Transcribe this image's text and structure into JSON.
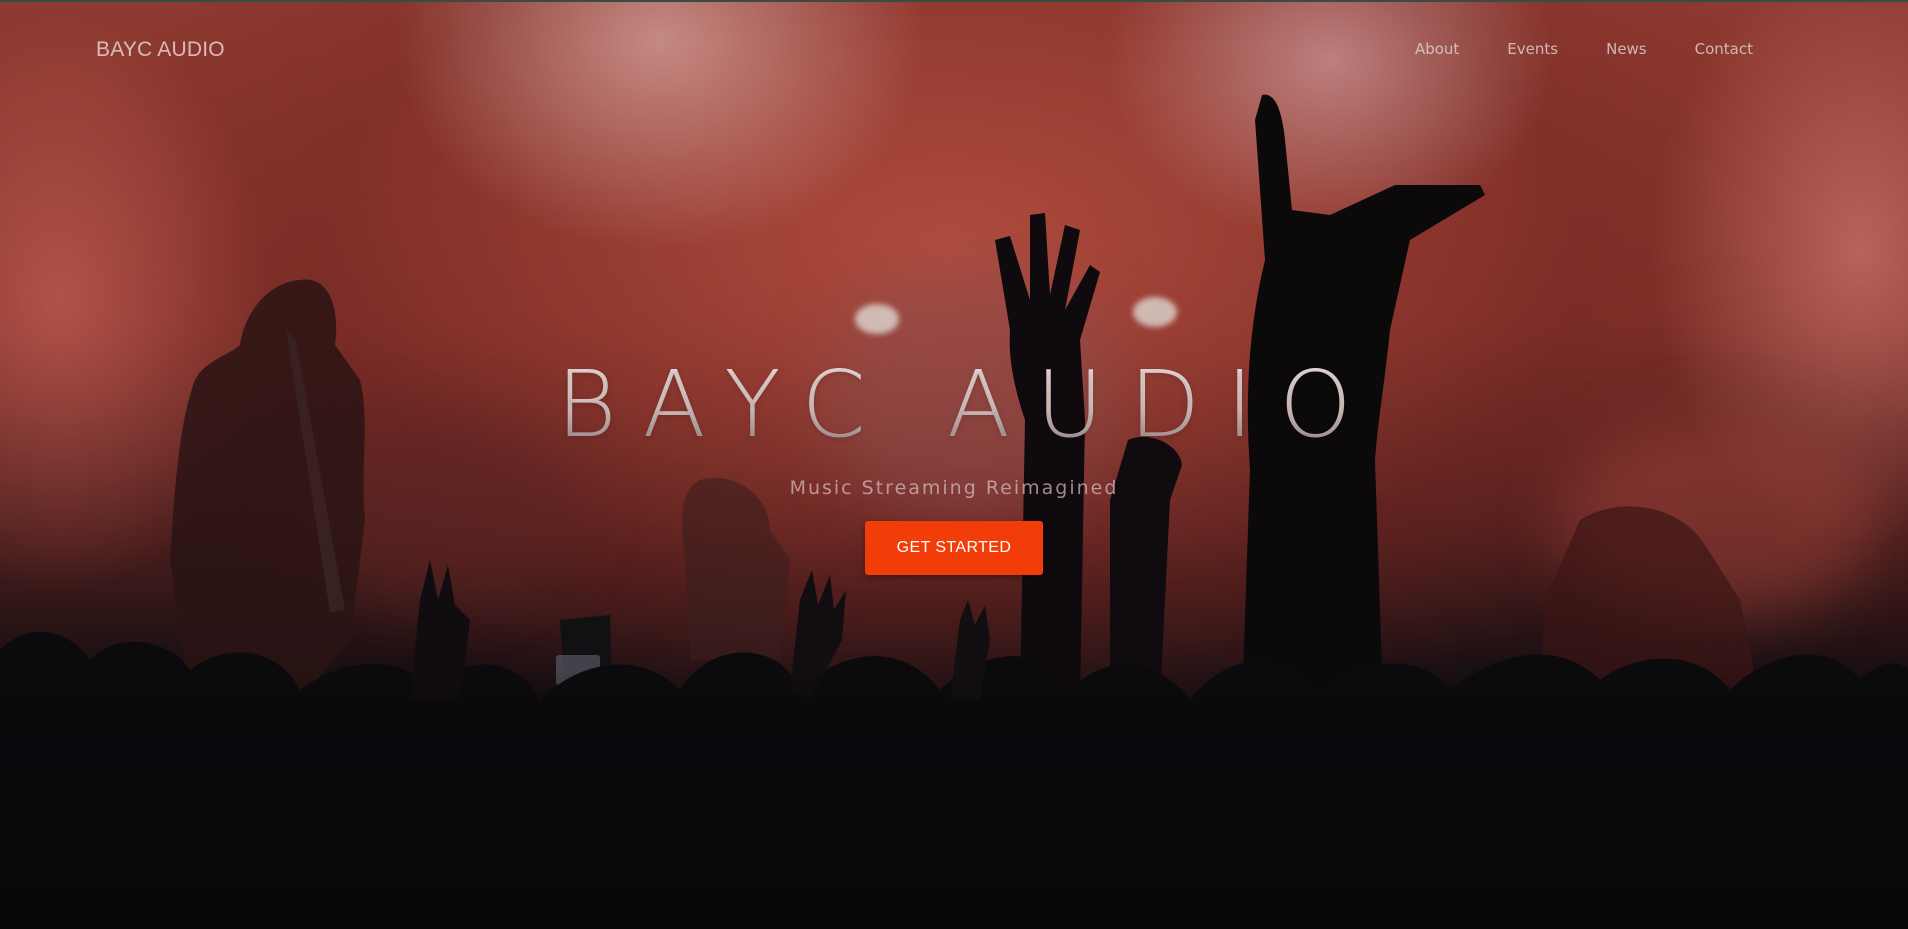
{
  "navbar": {
    "brand": "BAYC AUDIO",
    "links": [
      {
        "label": "About"
      },
      {
        "label": "Events"
      },
      {
        "label": "News"
      },
      {
        "label": "Contact"
      }
    ]
  },
  "hero": {
    "title": "BAYC AUDIO",
    "subtitle": "Music Streaming Reimagined",
    "cta_label": "GET STARTED",
    "background_image": "concert-crowd-silhouette"
  },
  "colors": {
    "accent": "#f23d08",
    "stage_red": "#8e3a30",
    "base_dark": "#07070a"
  }
}
